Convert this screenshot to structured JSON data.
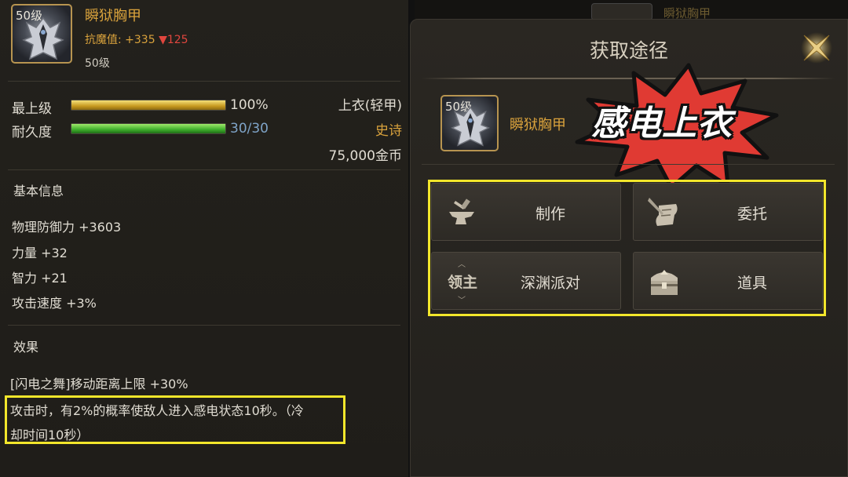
{
  "item_panel": {
    "icon_level": "50级",
    "name": "瞬狱胸甲",
    "resist_label": "抗魔值:",
    "resist_value": "+335",
    "resist_delta": "▼125",
    "level": "50级",
    "upgrade_label": "最上级",
    "upgrade_value": "100%",
    "upgrade_fraction": 1.0,
    "durability_label": "耐久度",
    "durability_value": "30/30",
    "durability_fraction": 1.0,
    "slot": "上衣(轻甲)",
    "rarity": "史诗",
    "price": "75,000金币",
    "basic_title": "基本信息",
    "attributes": [
      "物理防御力 +3603",
      "力量 +32",
      "智力 +21",
      "攻击速度 +3%"
    ],
    "effect_title": "效果",
    "effects": [
      "[闪电之舞]移动距离上限 +30%",
      "攻击时，有2%的概率使敌人进入感电状态10秒。（冷",
      "却时间10秒）"
    ]
  },
  "background": {
    "tab_text": "瞬狱胸甲"
  },
  "modal": {
    "title": "获取途径",
    "item_icon_level": "50级",
    "item_name": "瞬狱胸甲",
    "annotation": "感电上衣",
    "sources": [
      {
        "label": "制作",
        "icon": "anvil-icon"
      },
      {
        "label": "委托",
        "icon": "scroll-quill-icon"
      },
      {
        "label": "深渊派对",
        "icon": "lingzhu-selector",
        "icon_text": "领主"
      },
      {
        "label": "道具",
        "icon": "treasure-chest-icon"
      }
    ]
  },
  "colors": {
    "highlight": "#f2e62b",
    "gold_text": "#d9a23c",
    "burst_red": "#e03a33"
  }
}
